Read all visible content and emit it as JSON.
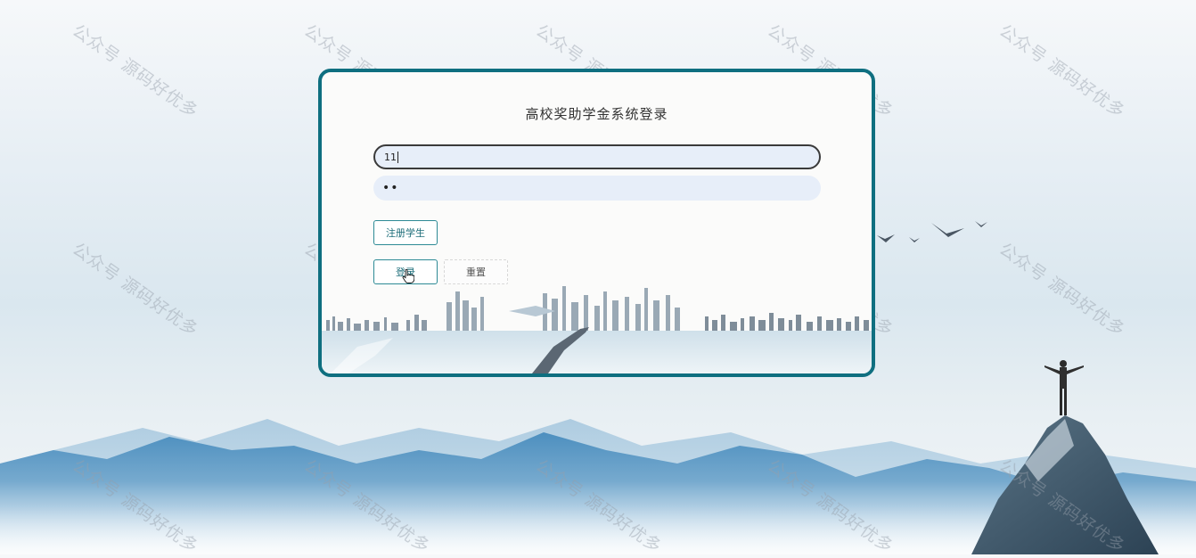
{
  "login": {
    "title": "高校奖助学金系统登录",
    "username_value": "11",
    "password_mask": "••",
    "register_label": "注册学生",
    "login_label": "登录",
    "reset_label": "重置"
  },
  "watermark": {
    "text": "公众号 源码好优多"
  },
  "colors": {
    "card_border": "#0f6f80",
    "field_bg": "#e7eef9",
    "button_text": "#1e6e7a"
  },
  "icons": {
    "cursor": "hand-pointer-icon",
    "birds": "birds-icon",
    "person": "person-on-peak-icon"
  }
}
